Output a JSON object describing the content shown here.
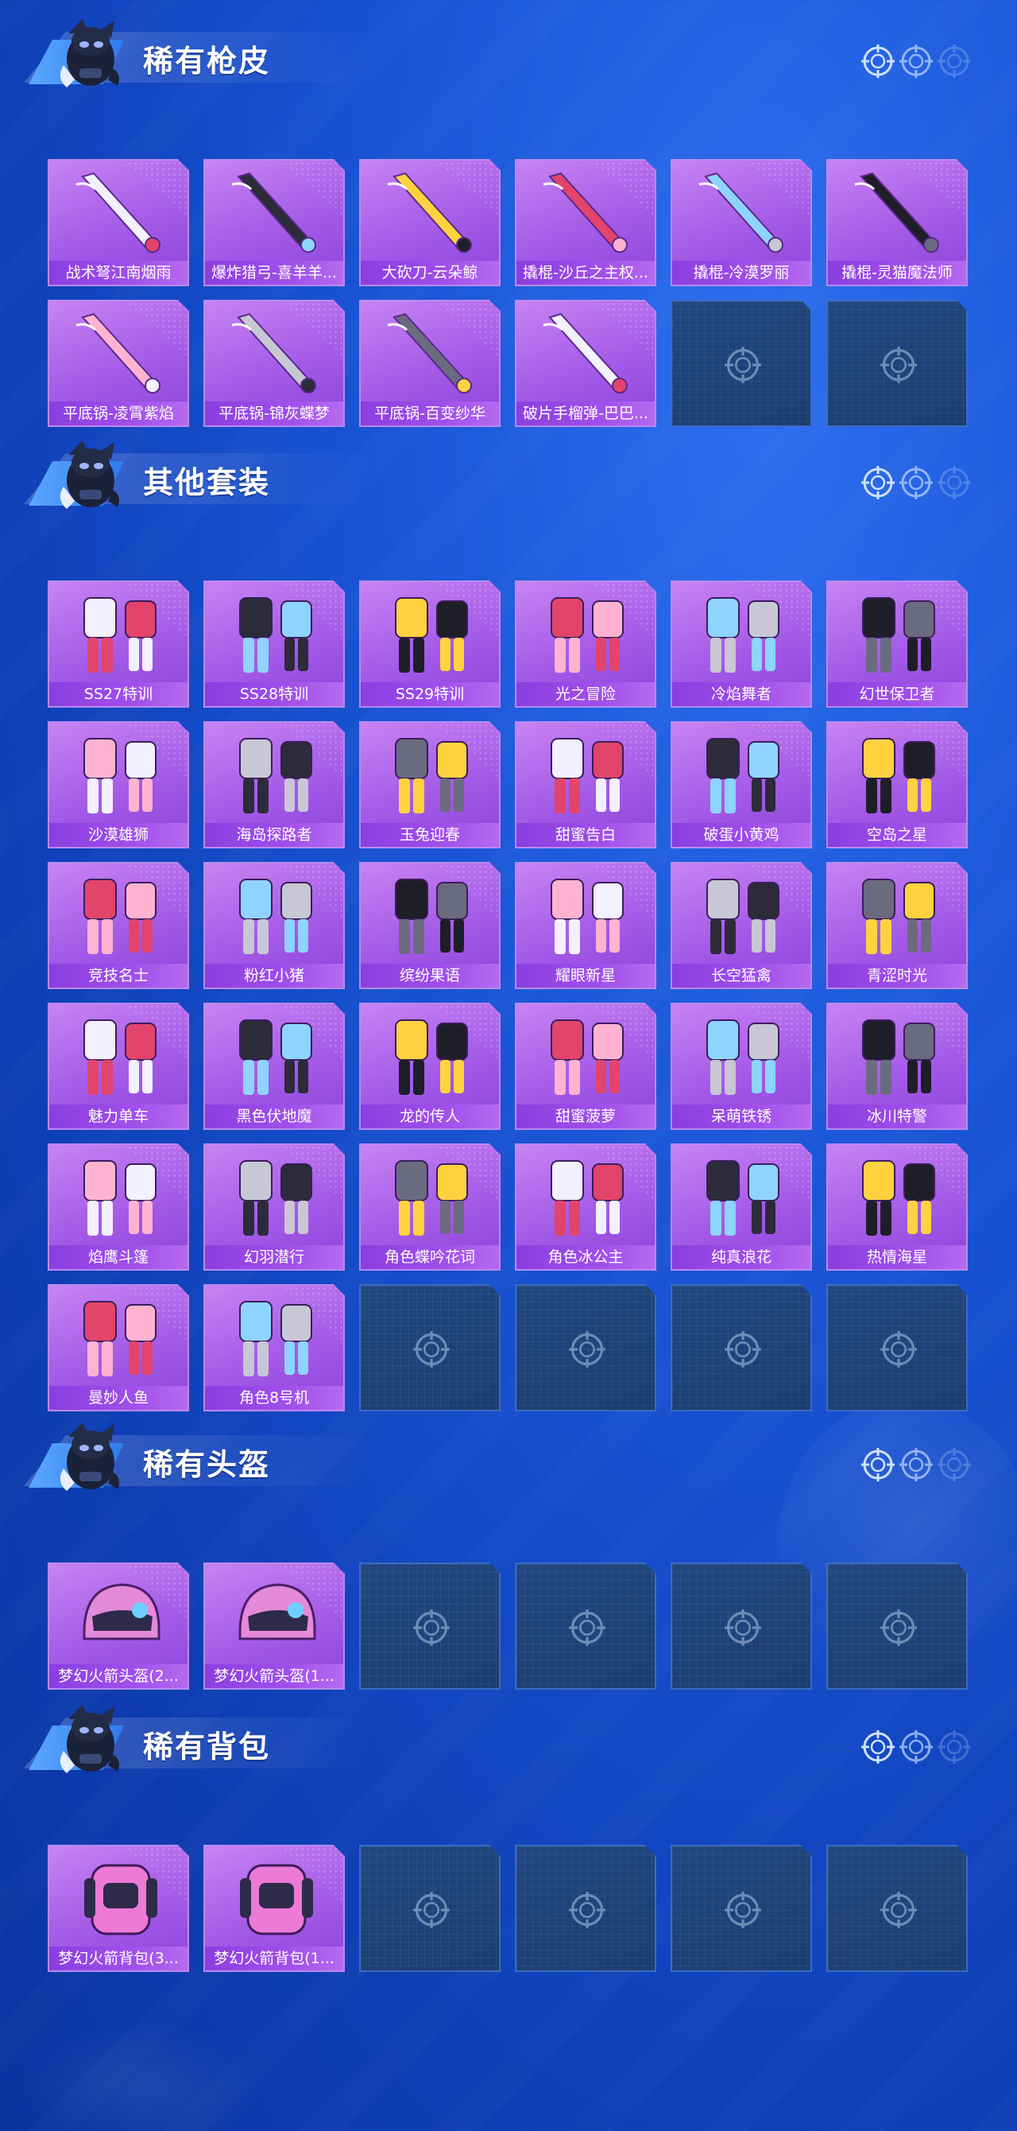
{
  "theme": {
    "accent_purple": "#a45be7",
    "label_purple": "#8b3ee0",
    "background_blue": "#1a55d6",
    "empty_slot": "#1f4478"
  },
  "sections": [
    {
      "title": "稀有枪皮",
      "items": [
        "战术弩江南烟雨",
        "爆炸猎弓-喜羊羊...",
        "大砍刀-云朵鲸",
        "撬棍-沙丘之主权...",
        "撬棍-冷漠罗丽",
        "撬棍-灵猫魔法师",
        "平底锅-凌霄紫焰",
        "平底锅-锦灰蝶梦",
        "平底锅-百变纱华",
        "破片手榴弹-巴巴..."
      ],
      "empty_slots": 2
    },
    {
      "title": "其他套装",
      "items": [
        "SS27特训",
        "SS28特训",
        "SS29特训",
        "光之冒险",
        "冷焰舞者",
        "幻世保卫者",
        "沙漠雄狮",
        "海岛探路者",
        "玉兔迎春",
        "甜蜜告白",
        "破蛋小黄鸡",
        "空岛之星",
        "竞技名士",
        "粉红小猪",
        "缤纷果语",
        "耀眼新星",
        "长空猛禽",
        "青涩时光",
        "魅力单车",
        "黑色伏地魔",
        "龙的传人",
        "甜蜜菠萝",
        "呆萌铁锈",
        "冰川特警",
        "焰鹰斗篷",
        "幻羽潜行",
        "角色蝶吟花词",
        "角色冰公主",
        "纯真浪花",
        "热情海星",
        "曼妙人鱼",
        "角色8号机"
      ],
      "empty_slots": 4
    },
    {
      "title": "稀有头盔",
      "items": [
        "梦幻火箭头盔(2...",
        "梦幻火箭头盔(1..."
      ],
      "empty_slots": 4
    },
    {
      "title": "稀有背包",
      "items": [
        "梦幻火箭背包(3...",
        "梦幻火箭背包(1..."
      ],
      "empty_slots": 4
    }
  ],
  "icons": {
    "header_mascot": "mascot-icon",
    "header_reticle": "reticle-icon",
    "empty_slot": "crosshair-icon"
  }
}
